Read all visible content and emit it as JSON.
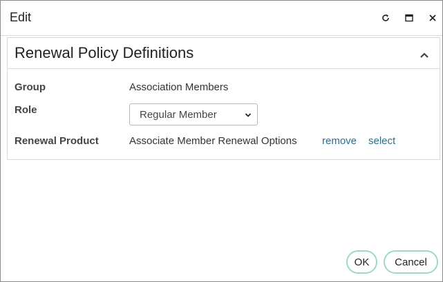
{
  "dialog": {
    "title": "Edit",
    "controls": {
      "refresh_icon": "refresh-icon",
      "maximize_icon": "maximize-icon",
      "close_icon": "close-icon"
    }
  },
  "panel": {
    "title": "Renewal Policy Definitions",
    "collapse_icon": "chevron-up-icon",
    "fields": {
      "group_label": "Group",
      "group_value": "Association Members",
      "role_label": "Role",
      "role_selected": "Regular Member",
      "renewal_product_label": "Renewal Product",
      "renewal_product_value": "Associate Member Renewal Options",
      "remove_link": "remove",
      "select_link": "select"
    }
  },
  "footer": {
    "ok_label": "OK",
    "cancel_label": "Cancel"
  },
  "colors": {
    "link": "#2a6f8c",
    "button_border": "#9fd9c4",
    "border": "#d8d8d8"
  }
}
